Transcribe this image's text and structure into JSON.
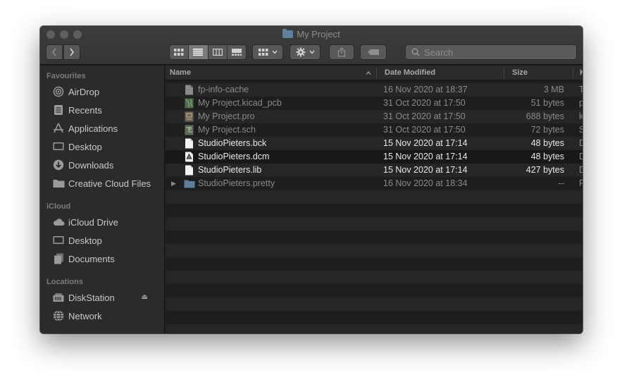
{
  "window": {
    "title": "My Project"
  },
  "toolbar": {
    "search_placeholder": "Search"
  },
  "sidebar": {
    "sections": [
      {
        "label": "Favourites",
        "items": [
          {
            "label": "AirDrop",
            "icon": "airdrop-icon"
          },
          {
            "label": "Recents",
            "icon": "recents-icon"
          },
          {
            "label": "Applications",
            "icon": "applications-icon"
          },
          {
            "label": "Desktop",
            "icon": "desktop-icon"
          },
          {
            "label": "Downloads",
            "icon": "downloads-icon"
          },
          {
            "label": "Creative Cloud Files",
            "icon": "folder-icon"
          }
        ]
      },
      {
        "label": "iCloud",
        "items": [
          {
            "label": "iCloud Drive",
            "icon": "cloud-icon"
          },
          {
            "label": "Desktop",
            "icon": "desktop-icon"
          },
          {
            "label": "Documents",
            "icon": "documents-icon"
          }
        ]
      },
      {
        "label": "Locations",
        "items": [
          {
            "label": "DiskStation",
            "icon": "server-icon"
          },
          {
            "label": "Network",
            "icon": "globe-icon"
          }
        ]
      }
    ]
  },
  "columns": {
    "name": "Name",
    "date": "Date Modified",
    "size": "Size",
    "kind": "K"
  },
  "files": [
    {
      "name": "fp-info-cache",
      "date": "16 Nov 2020 at 18:37",
      "size": "3 MB",
      "kind": "T",
      "icon": "document-icon"
    },
    {
      "name": "My Project.kicad_pcb",
      "date": "31 Oct 2020 at 17:50",
      "size": "51 bytes",
      "kind": "p",
      "icon": "pcb-file-icon"
    },
    {
      "name": "My Project.pro",
      "date": "31 Oct 2020 at 17:50",
      "size": "688 bytes",
      "kind": "k",
      "icon": "project-file-icon"
    },
    {
      "name": "My Project.sch",
      "date": "31 Oct 2020 at 17:50",
      "size": "72 bytes",
      "kind": "S",
      "icon": "schematic-file-icon"
    },
    {
      "name": "StudioPieters.bck",
      "date": "15 Nov 2020 at 17:14",
      "size": "48 bytes",
      "kind": "D",
      "icon": "document-icon"
    },
    {
      "name": "StudioPieters.dcm",
      "date": "15 Nov 2020 at 17:14",
      "size": "48 bytes",
      "kind": "D",
      "icon": "dcm-file-icon"
    },
    {
      "name": "StudioPieters.lib",
      "date": "15 Nov 2020 at 17:14",
      "size": "427 bytes",
      "kind": "D",
      "icon": "document-icon"
    },
    {
      "name": "StudioPieters.pretty",
      "date": "16 Nov 2020 at 18:34",
      "size": "--",
      "kind": "F",
      "icon": "folder-icon"
    }
  ]
}
